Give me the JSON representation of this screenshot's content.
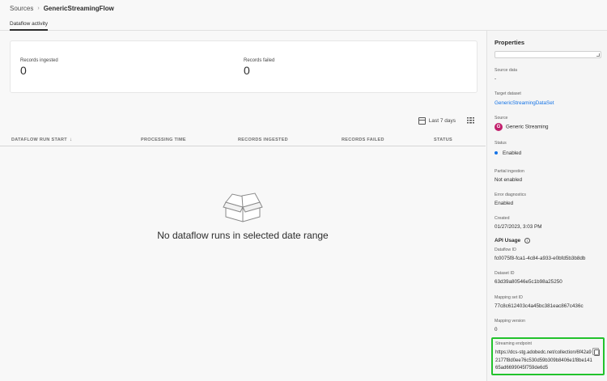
{
  "breadcrumb": {
    "parent": "Sources",
    "separator": "›",
    "current": "GenericStreamingFlow"
  },
  "tab": {
    "label": "Dataflow activity"
  },
  "metrics": {
    "ingested_label": "Records ingested",
    "ingested_value": "0",
    "failed_label": "Records failed",
    "failed_value": "0"
  },
  "filter": {
    "label": "Last 7 days"
  },
  "table": {
    "columns": [
      "DATAFLOW RUN START",
      "PROCESSING TIME",
      "RECORDS INGESTED",
      "RECORDS FAILED",
      "STATUS"
    ],
    "sort_icon": "arrow-down-icon",
    "empty_message": "No dataflow runs in selected date range"
  },
  "properties": {
    "title": "Properties",
    "source_data_label": "Source data",
    "source_data_value": "-",
    "target_dataset_label": "Target dataset",
    "target_dataset_value": "GenericStreamingDataSet",
    "source_label": "Source",
    "source_badge": "G",
    "source_value": "Generic Streaming",
    "status_label": "Status",
    "status_value": "Enabled",
    "partial_label": "Partial ingestion",
    "partial_value": "Not enabled",
    "error_label": "Error diagnostics",
    "error_value": "Enabled",
    "created_label": "Created",
    "created_value": "01/27/2023, 3:03 PM",
    "api_title": "API Usage",
    "dataflow_id_label": "Dataflow ID",
    "dataflow_id_value": "fc0075f8-fca1-4c84-a933-e0bfd5b3b8db",
    "dataset_id_label": "Dataset ID",
    "dataset_id_value": "63d39a80546e5c1b98a25250",
    "mapping_set_label": "Mapping set ID",
    "mapping_set_value": "77c8c612403c4a45bc381eac867c436c",
    "mapping_version_label": "Mapping version",
    "mapping_version_value": "0",
    "endpoint_label": "Streaming endpoint",
    "endpoint_value": "https://dcs-stg.adobedc.net/collection/6f42a92177f8d0ee76c530d59b309b8406e1f8be14165ad6699045f759de6d5"
  },
  "colors": {
    "link": "#1473e6",
    "badge": "#c11e6b",
    "highlight": "#22c22c",
    "status_dot": "#1473e6"
  }
}
